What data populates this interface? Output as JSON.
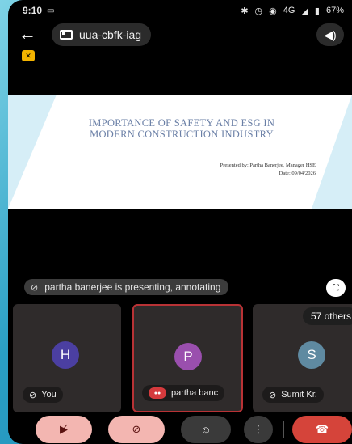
{
  "status": {
    "time": "9:10",
    "icons_text": "4G",
    "battery": "67%"
  },
  "meeting": {
    "code": "uua-cbfk-iag"
  },
  "slide": {
    "title_line1": "IMPORTANCE OF SAFETY AND ESG IN",
    "title_line2": "MODERN CONSTRUCTION INDUSTRY",
    "presented_by": "Presented by: Partha Banerjee, Manager HSE",
    "date": "Date: 09/04/2026"
  },
  "presenting_banner": "partha banerjee is presenting, annotating",
  "tiles": [
    {
      "initial": "H",
      "name": "You"
    },
    {
      "initial": "P",
      "name": "partha banc"
    },
    {
      "initial": "S",
      "name": "Sumit Kr."
    }
  ],
  "others_count": "57 others",
  "controls": {
    "camera": "camera-off",
    "mic": "mic-off",
    "emoji": "emoji",
    "more": "more",
    "end": "end-call"
  },
  "colors": {
    "end_call": "#d5443a",
    "muted_control": "#f3b6b1",
    "active_speaker_border": "#b83235"
  }
}
